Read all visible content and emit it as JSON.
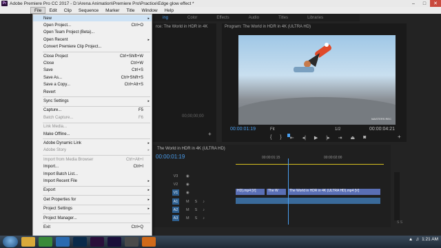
{
  "titlebar": {
    "icon_text": "Pr",
    "title": "Adobe Premiere Pro CC 2017 - D:\\Arena Animation\\Premiere Pro\\Practice\\Edge glow effect *",
    "minimize": "–",
    "maximize": "□",
    "close": "✕"
  },
  "menubar": {
    "items": [
      "File",
      "Edit",
      "Clip",
      "Sequence",
      "Marker",
      "Title",
      "Window",
      "Help"
    ]
  },
  "panel_tabs": [
    "ing",
    "Color",
    "Effects",
    "Audio",
    "Titles",
    "Libraries"
  ],
  "source_monitor": {
    "title": "rce: The World in HDR in 4K",
    "timecode": "00;00;00;00"
  },
  "program_monitor": {
    "title": "Program: The World in HDR in 4K (ULTRA HD)",
    "timecode": "00:00:01:19",
    "fit": "Fit",
    "resolution": "1/2",
    "duration": "00:00:04:21",
    "watermark": "MASTERS REC"
  },
  "timeline": {
    "title": "The World in HDR in 4K (ULTRA HD)",
    "timecode": "00:00:01:19",
    "ruler_marks": [
      "00:00:01:15",
      "00:00:02:00"
    ],
    "video_tracks": [
      "V3",
      "V2",
      "V1"
    ],
    "audio_tracks": [
      "A1",
      "A2",
      "A3"
    ],
    "clips": [
      "HD).mp4 [V]",
      "The W",
      "The World in HDR in 4K (ULTRA HD).mp4 [V]"
    ],
    "audio_meter_label": "S S"
  },
  "file_menu": {
    "items": [
      {
        "label": "New",
        "shortcut": "",
        "arrow": "▸",
        "disabled": false,
        "highlight": true
      },
      {
        "label": "Open Project...",
        "shortcut": "Ctrl+O",
        "arrow": "",
        "disabled": false
      },
      {
        "label": "Open Team Project (Beta)...",
        "shortcut": "",
        "arrow": "",
        "disabled": false
      },
      {
        "label": "Open Recent",
        "shortcut": "",
        "arrow": "▸",
        "disabled": false
      },
      {
        "label": "Convert Premiere Clip Project...",
        "shortcut": "",
        "arrow": "",
        "disabled": false
      },
      {
        "sep": true
      },
      {
        "label": "Close Project",
        "shortcut": "Ctrl+Shift+W",
        "arrow": "",
        "disabled": false
      },
      {
        "label": "Close",
        "shortcut": "Ctrl+W",
        "arrow": "",
        "disabled": false
      },
      {
        "label": "Save",
        "shortcut": "Ctrl+S",
        "arrow": "",
        "disabled": false
      },
      {
        "label": "Save As...",
        "shortcut": "Ctrl+Shift+S",
        "arrow": "",
        "disabled": false
      },
      {
        "label": "Save a Copy...",
        "shortcut": "Ctrl+Alt+S",
        "arrow": "",
        "disabled": false
      },
      {
        "label": "Revert",
        "shortcut": "",
        "arrow": "",
        "disabled": false
      },
      {
        "sep": true
      },
      {
        "label": "Sync Settings",
        "shortcut": "",
        "arrow": "▸",
        "disabled": false
      },
      {
        "sep": true
      },
      {
        "label": "Capture...",
        "shortcut": "F5",
        "arrow": "",
        "disabled": false
      },
      {
        "label": "Batch Capture...",
        "shortcut": "F6",
        "arrow": "",
        "disabled": true
      },
      {
        "sep": true
      },
      {
        "label": "Link Media...",
        "shortcut": "",
        "arrow": "",
        "disabled": true
      },
      {
        "label": "Make Offline...",
        "shortcut": "",
        "arrow": "",
        "disabled": false
      },
      {
        "sep": true
      },
      {
        "label": "Adobe Dynamic Link",
        "shortcut": "",
        "arrow": "▸",
        "disabled": false
      },
      {
        "label": "Adobe Story",
        "shortcut": "",
        "arrow": "▸",
        "disabled": true
      },
      {
        "sep": true
      },
      {
        "label": "Import from Media Browser",
        "shortcut": "Ctrl+Alt+I",
        "arrow": "",
        "disabled": true
      },
      {
        "label": "Import...",
        "shortcut": "Ctrl+I",
        "arrow": "",
        "disabled": false
      },
      {
        "label": "Import Batch List...",
        "shortcut": "",
        "arrow": "",
        "disabled": false
      },
      {
        "label": "Import Recent File",
        "shortcut": "",
        "arrow": "▸",
        "disabled": false
      },
      {
        "sep": true
      },
      {
        "label": "Export",
        "shortcut": "",
        "arrow": "▸",
        "disabled": false
      },
      {
        "sep": true
      },
      {
        "label": "Get Properties for",
        "shortcut": "",
        "arrow": "▸",
        "disabled": false
      },
      {
        "sep": true
      },
      {
        "label": "Project Settings",
        "shortcut": "",
        "arrow": "▸",
        "disabled": false
      },
      {
        "sep": true
      },
      {
        "label": "Project Manager...",
        "shortcut": "",
        "arrow": "",
        "disabled": false
      },
      {
        "sep": true
      },
      {
        "label": "Exit",
        "shortcut": "Ctrl+Q",
        "arrow": "",
        "disabled": false
      }
    ]
  },
  "taskbar": {
    "apps": [
      "explorer-icon",
      "chrome-icon",
      "ie-icon",
      "photoshop-icon",
      "premiere-icon",
      "aftereffects-icon",
      "media-icon",
      "vlc-icon"
    ],
    "time": "1:21 AM"
  },
  "colors": {
    "accent_blue": "#4a9ff0",
    "menu_highlight": "#cde2f5",
    "app_bg": "#232323"
  }
}
